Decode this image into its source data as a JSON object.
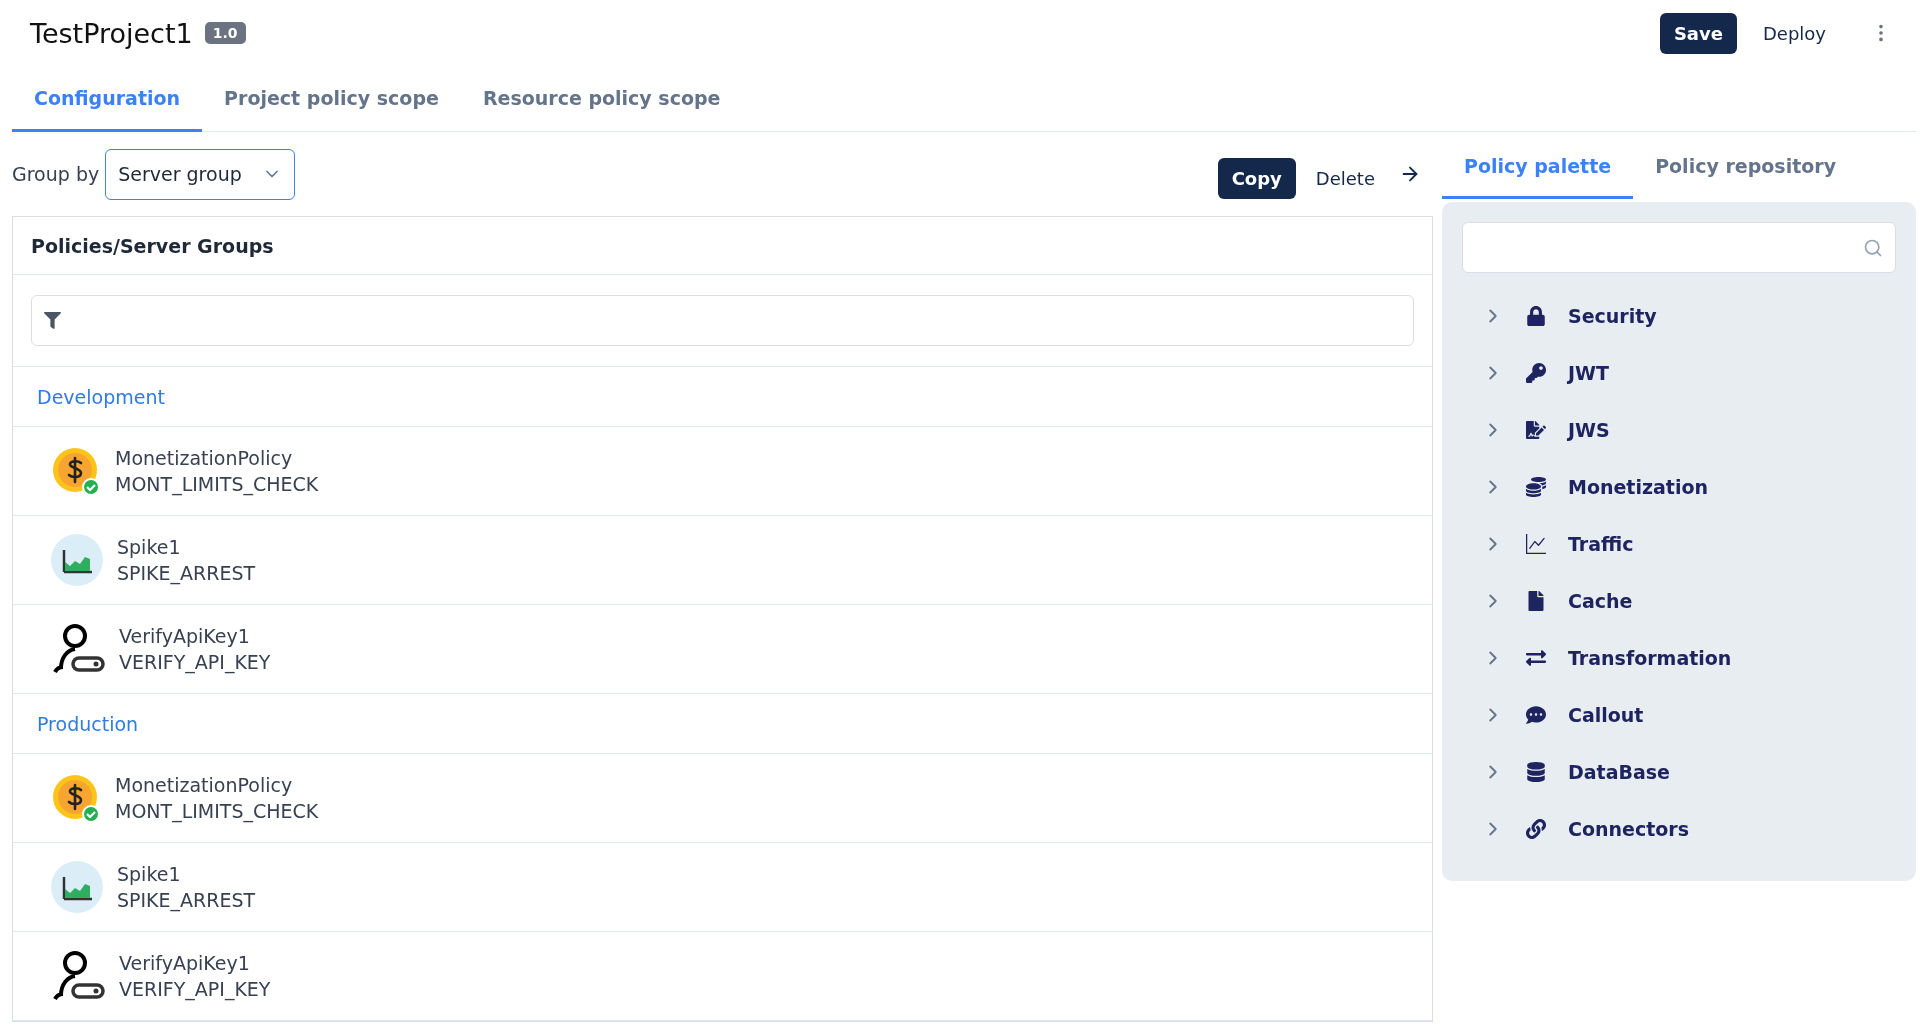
{
  "header": {
    "title": "TestProject1",
    "version": "1.0",
    "buttons": [
      "Save",
      "Deploy"
    ]
  },
  "tabs": [
    {
      "label": "Configuration",
      "selected": true
    },
    {
      "label": "Project policy scope",
      "selected": false
    },
    {
      "label": "Resource policy scope",
      "selected": false
    }
  ],
  "toolbar": {
    "group_by_label": "Group by",
    "group_by_value": "Server group",
    "actions": [
      "Copy",
      "Delete"
    ]
  },
  "policies": {
    "title": "Policies/Server Groups",
    "groups": [
      {
        "name": "Development",
        "items": [
          {
            "kind": "monetization",
            "name": "MonetizationPolicy",
            "type": "MONT_LIMITS_CHECK"
          },
          {
            "kind": "spike",
            "name": "Spike1",
            "type": "SPIKE_ARREST"
          },
          {
            "kind": "apikey",
            "name": "VerifyApiKey1",
            "type": "VERIFY_API_KEY"
          }
        ]
      },
      {
        "name": "Production",
        "items": [
          {
            "kind": "monetization",
            "name": "MonetizationPolicy",
            "type": "MONT_LIMITS_CHECK"
          },
          {
            "kind": "spike",
            "name": "Spike1",
            "type": "SPIKE_ARREST"
          },
          {
            "kind": "apikey",
            "name": "VerifyApiKey1",
            "type": "VERIFY_API_KEY"
          }
        ]
      }
    ]
  },
  "palette": {
    "tabs": [
      {
        "label": "Policy palette",
        "selected": true
      },
      {
        "label": "Policy repository",
        "selected": false
      }
    ],
    "categories": [
      {
        "kind": "lock",
        "label": "Security",
        "expanded": false
      },
      {
        "kind": "key",
        "label": "JWT",
        "expanded": false
      },
      {
        "kind": "signature",
        "label": "JWS",
        "expanded": false
      },
      {
        "kind": "coins",
        "label": "Monetization",
        "expanded": false
      },
      {
        "kind": "chart",
        "label": "Traffic",
        "expanded": false
      },
      {
        "kind": "file",
        "label": "Cache",
        "expanded": false
      },
      {
        "kind": "exchange",
        "label": "Transformation",
        "expanded": false
      },
      {
        "kind": "comment",
        "label": "Callout",
        "expanded": false
      },
      {
        "kind": "database",
        "label": "DataBase",
        "expanded": false
      },
      {
        "kind": "link",
        "label": "Connectors",
        "expanded": false
      }
    ]
  }
}
